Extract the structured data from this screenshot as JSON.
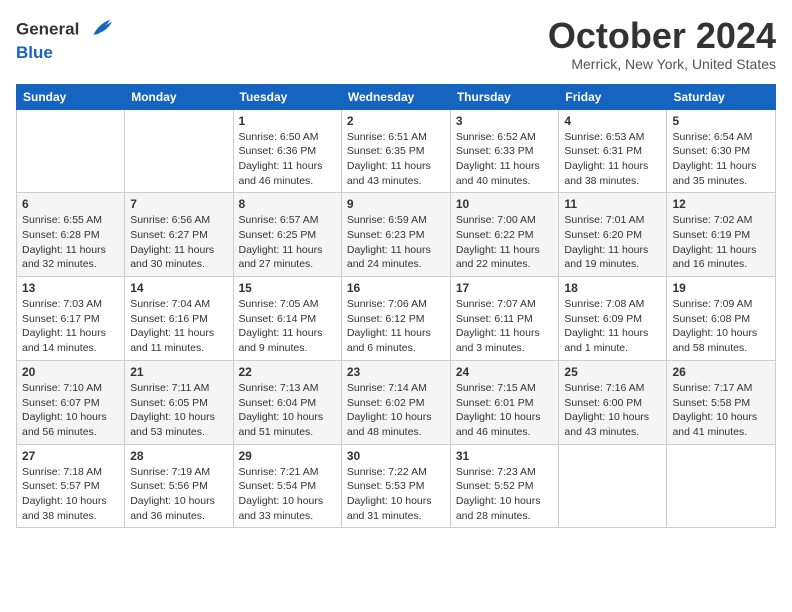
{
  "header": {
    "logo_text1": "General",
    "logo_text2": "Blue",
    "month": "October 2024",
    "location": "Merrick, New York, United States"
  },
  "weekdays": [
    "Sunday",
    "Monday",
    "Tuesday",
    "Wednesday",
    "Thursday",
    "Friday",
    "Saturday"
  ],
  "weeks": [
    [
      {
        "day": "",
        "info": ""
      },
      {
        "day": "",
        "info": ""
      },
      {
        "day": "1",
        "info": "Sunrise: 6:50 AM\nSunset: 6:36 PM\nDaylight: 11 hours and 46 minutes."
      },
      {
        "day": "2",
        "info": "Sunrise: 6:51 AM\nSunset: 6:35 PM\nDaylight: 11 hours and 43 minutes."
      },
      {
        "day": "3",
        "info": "Sunrise: 6:52 AM\nSunset: 6:33 PM\nDaylight: 11 hours and 40 minutes."
      },
      {
        "day": "4",
        "info": "Sunrise: 6:53 AM\nSunset: 6:31 PM\nDaylight: 11 hours and 38 minutes."
      },
      {
        "day": "5",
        "info": "Sunrise: 6:54 AM\nSunset: 6:30 PM\nDaylight: 11 hours and 35 minutes."
      }
    ],
    [
      {
        "day": "6",
        "info": "Sunrise: 6:55 AM\nSunset: 6:28 PM\nDaylight: 11 hours and 32 minutes."
      },
      {
        "day": "7",
        "info": "Sunrise: 6:56 AM\nSunset: 6:27 PM\nDaylight: 11 hours and 30 minutes."
      },
      {
        "day": "8",
        "info": "Sunrise: 6:57 AM\nSunset: 6:25 PM\nDaylight: 11 hours and 27 minutes."
      },
      {
        "day": "9",
        "info": "Sunrise: 6:59 AM\nSunset: 6:23 PM\nDaylight: 11 hours and 24 minutes."
      },
      {
        "day": "10",
        "info": "Sunrise: 7:00 AM\nSunset: 6:22 PM\nDaylight: 11 hours and 22 minutes."
      },
      {
        "day": "11",
        "info": "Sunrise: 7:01 AM\nSunset: 6:20 PM\nDaylight: 11 hours and 19 minutes."
      },
      {
        "day": "12",
        "info": "Sunrise: 7:02 AM\nSunset: 6:19 PM\nDaylight: 11 hours and 16 minutes."
      }
    ],
    [
      {
        "day": "13",
        "info": "Sunrise: 7:03 AM\nSunset: 6:17 PM\nDaylight: 11 hours and 14 minutes."
      },
      {
        "day": "14",
        "info": "Sunrise: 7:04 AM\nSunset: 6:16 PM\nDaylight: 11 hours and 11 minutes."
      },
      {
        "day": "15",
        "info": "Sunrise: 7:05 AM\nSunset: 6:14 PM\nDaylight: 11 hours and 9 minutes."
      },
      {
        "day": "16",
        "info": "Sunrise: 7:06 AM\nSunset: 6:12 PM\nDaylight: 11 hours and 6 minutes."
      },
      {
        "day": "17",
        "info": "Sunrise: 7:07 AM\nSunset: 6:11 PM\nDaylight: 11 hours and 3 minutes."
      },
      {
        "day": "18",
        "info": "Sunrise: 7:08 AM\nSunset: 6:09 PM\nDaylight: 11 hours and 1 minute."
      },
      {
        "day": "19",
        "info": "Sunrise: 7:09 AM\nSunset: 6:08 PM\nDaylight: 10 hours and 58 minutes."
      }
    ],
    [
      {
        "day": "20",
        "info": "Sunrise: 7:10 AM\nSunset: 6:07 PM\nDaylight: 10 hours and 56 minutes."
      },
      {
        "day": "21",
        "info": "Sunrise: 7:11 AM\nSunset: 6:05 PM\nDaylight: 10 hours and 53 minutes."
      },
      {
        "day": "22",
        "info": "Sunrise: 7:13 AM\nSunset: 6:04 PM\nDaylight: 10 hours and 51 minutes."
      },
      {
        "day": "23",
        "info": "Sunrise: 7:14 AM\nSunset: 6:02 PM\nDaylight: 10 hours and 48 minutes."
      },
      {
        "day": "24",
        "info": "Sunrise: 7:15 AM\nSunset: 6:01 PM\nDaylight: 10 hours and 46 minutes."
      },
      {
        "day": "25",
        "info": "Sunrise: 7:16 AM\nSunset: 6:00 PM\nDaylight: 10 hours and 43 minutes."
      },
      {
        "day": "26",
        "info": "Sunrise: 7:17 AM\nSunset: 5:58 PM\nDaylight: 10 hours and 41 minutes."
      }
    ],
    [
      {
        "day": "27",
        "info": "Sunrise: 7:18 AM\nSunset: 5:57 PM\nDaylight: 10 hours and 38 minutes."
      },
      {
        "day": "28",
        "info": "Sunrise: 7:19 AM\nSunset: 5:56 PM\nDaylight: 10 hours and 36 minutes."
      },
      {
        "day": "29",
        "info": "Sunrise: 7:21 AM\nSunset: 5:54 PM\nDaylight: 10 hours and 33 minutes."
      },
      {
        "day": "30",
        "info": "Sunrise: 7:22 AM\nSunset: 5:53 PM\nDaylight: 10 hours and 31 minutes."
      },
      {
        "day": "31",
        "info": "Sunrise: 7:23 AM\nSunset: 5:52 PM\nDaylight: 10 hours and 28 minutes."
      },
      {
        "day": "",
        "info": ""
      },
      {
        "day": "",
        "info": ""
      }
    ]
  ]
}
